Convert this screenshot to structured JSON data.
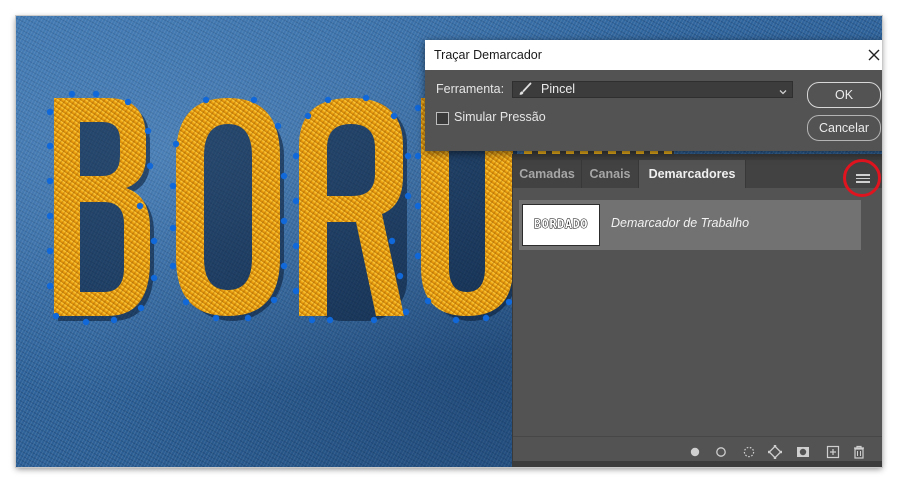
{
  "dialog": {
    "title": "Traçar Demarcador",
    "tool_label": "Ferramenta:",
    "tool_value": "Pincel",
    "simulate_pressure_label": "Simular Pressão",
    "simulate_pressure_checked": false,
    "ok_label": "OK",
    "cancel_label": "Cancelar"
  },
  "panel": {
    "tabs": [
      {
        "label": "Camadas",
        "active": false
      },
      {
        "label": "Canais",
        "active": false
      },
      {
        "label": "Demarcadores",
        "active": true
      }
    ],
    "paths": [
      {
        "thumbnail_text": "BORDADO",
        "label": "Demarcador de Trabalho",
        "selected": true
      }
    ],
    "footer_icons": [
      "fill-path-icon",
      "stroke-path-icon",
      "load-as-selection-icon",
      "make-work-path-icon",
      "add-mask-icon",
      "new-path-icon",
      "delete-path-icon"
    ],
    "menu_icon": "panel-menu-icon"
  },
  "canvas": {
    "visible_letters": "BORU"
  },
  "colors": {
    "embroidery_gold": "#f2a812",
    "path_anchor_blue": "#1168d8",
    "denim_blue": "#2f649c",
    "panel_bg": "#535353",
    "highlight_circle": "#e0141f"
  }
}
